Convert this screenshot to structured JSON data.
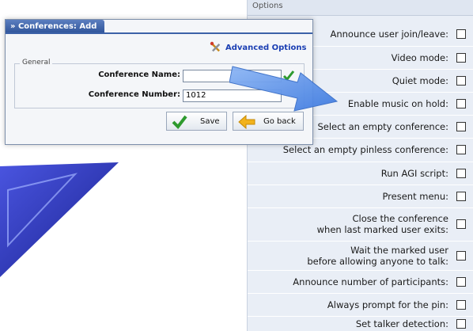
{
  "dialog": {
    "title": "» Conferences: Add",
    "advanced_options": "Advanced Options",
    "general_legend": "General",
    "conference_name_label": "Conference Name:",
    "conference_name_value": "",
    "conference_number_label": "Conference Number:",
    "conference_number_value": "1012",
    "save_label": "Save",
    "goback_label": "Go back"
  },
  "options": {
    "header": "Options",
    "items": [
      {
        "label": "Announce user join/leave:",
        "checked": false
      },
      {
        "label": "Video mode:",
        "checked": false
      },
      {
        "label": "Quiet mode:",
        "checked": false
      },
      {
        "label": "Enable music on hold:",
        "checked": false
      },
      {
        "label": "Select an empty conference:",
        "checked": false
      },
      {
        "label": "Select an empty pinless conference:",
        "checked": false
      },
      {
        "label": "Run AGI script:",
        "checked": false
      },
      {
        "label": "Present menu:",
        "checked": false
      },
      {
        "label_line1": "Close the conference",
        "label_line2": "when last marked user exits:",
        "checked": false
      },
      {
        "label_line1": "Wait the marked user",
        "label_line2": "before allowing anyone to talk:",
        "checked": false
      },
      {
        "label": "Announce number of participants:",
        "checked": false
      },
      {
        "label": "Always prompt for the pin:",
        "checked": false
      },
      {
        "label": "Set talker detection:",
        "checked": false
      }
    ]
  },
  "colors": {
    "accent": "#2f549a",
    "panel_bg": "#e9eef6",
    "arrow": "#5b8fe0",
    "triangle": "#2a35b8"
  }
}
